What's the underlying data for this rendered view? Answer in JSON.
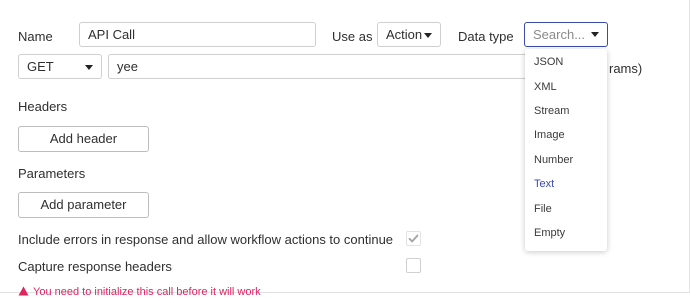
{
  "form": {
    "name_label": "Name",
    "name_value": "API Call",
    "use_as_label": "Use as",
    "use_as_value": "Action",
    "data_type_label": "Data type",
    "data_type_search_placeholder": "Search...",
    "method_value": "GET",
    "url_value": "yee",
    "url_hint_partial": "rams)",
    "headers_label": "Headers",
    "add_header_label": "Add header",
    "parameters_label": "Parameters",
    "add_parameter_label": "Add parameter",
    "include_errors_label": "Include errors in response and allow workflow actions to continue",
    "include_errors_checked": true,
    "capture_headers_label": "Capture response headers",
    "capture_headers_checked": false,
    "warning_partial": "You need to initialize this call before it will work"
  },
  "data_type_options": [
    "JSON",
    "XML",
    "Stream",
    "Image",
    "Number",
    "Text",
    "File",
    "Empty"
  ],
  "data_type_highlighted": "Text",
  "colors": {
    "accent": "#3a4ab5",
    "warning": "#e0245e",
    "border": "#cfcfcf"
  }
}
